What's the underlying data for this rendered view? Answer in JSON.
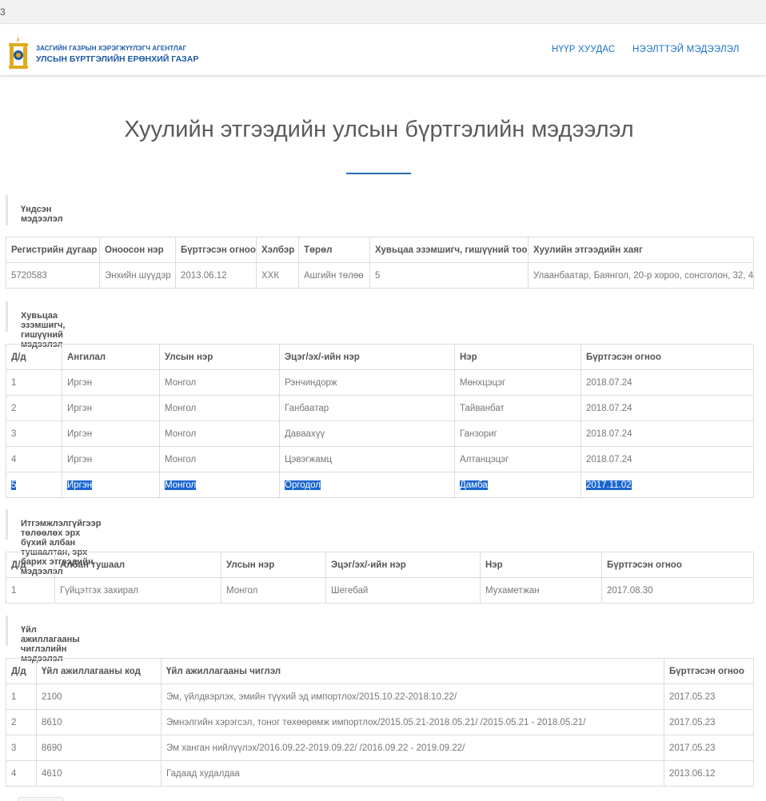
{
  "browser": {
    "strip_text": "3"
  },
  "header": {
    "logo_line1": "ЗАСГИЙН ГАЗРЫН ХЭРЭГЖҮҮЛЭГЧ АГЕНТЛАГ",
    "logo_line2": "УЛСЫН БҮРТГЭЛИЙН ЕРӨНХИЙ ГАЗАР",
    "nav": [
      {
        "label": "НҮҮР ХУУДАС"
      },
      {
        "label": "НЭЭЛТТЭЙ МЭДЭЭЛЭЛ"
      }
    ]
  },
  "page": {
    "title": "Хуулийн этгээдийн улсын бүртгэлийн мэдээлэл"
  },
  "basic": {
    "heading": "Үндсэн мэдээлэл",
    "columns": [
      "Регистрийн дугаар",
      "Оноосон нэр",
      "Бүртгэсэн огноо",
      "Хэлбэр",
      "Төрөл",
      "Хувьцаа эзэмшигч, гишүүний тоо",
      "Хуулийн этгээдийн хаяг"
    ],
    "rows": [
      [
        "5720583",
        "Энхийн шүүдэр",
        "2013.06.12",
        "ХХК",
        "Ашгийн төлөө",
        "5",
        "Улаанбаатар, Баянгол, 20-р хороо, сонсголон, 32, 4"
      ]
    ]
  },
  "shareholders": {
    "heading": "Хувьцаа эзэмшигч, гишүүний мэдээлэл",
    "columns": [
      "Д/д",
      "Ангилал",
      "Улсын нэр",
      "Эцэг/эх/-ийн нэр",
      "Нэр",
      "Бүртгэсэн огноо"
    ],
    "rows": [
      [
        "1",
        "Иргэн",
        "Монгол",
        "Рэнчиндорж",
        "Мөнхцэцэг",
        "2018.07.24"
      ],
      [
        "2",
        "Иргэн",
        "Монгол",
        "Ганбаатар",
        "Тайванбат",
        "2018.07.24"
      ],
      [
        "3",
        "Иргэн",
        "Монгол",
        "Даваахүү",
        "Ганзориг",
        "2018.07.24"
      ],
      [
        "4",
        "Иргэн",
        "Монгол",
        "Цэвэгжамц",
        "Алтанцэцэг",
        "2018.07.24"
      ],
      [
        "5",
        "Иргэн",
        "Монгол",
        "Оргодол",
        "Дамба",
        "2017.11.02"
      ]
    ]
  },
  "officials": {
    "heading": "Итгэмжлэлгүйгээр төлөөлөх эрх бүхий албан тушаалтан, эрх барих этгээдийн мэдээлэл",
    "columns": [
      "Д/д",
      "Албан тушаал",
      "Улсын нэр",
      "Эцэг/эх/-ийн нэр",
      "Нэр",
      "Бүртгэсэн огноо"
    ],
    "rows": [
      [
        "1",
        "Гүйцэтгэх захирал",
        "Монгол",
        "Шегебай",
        "Мухаметжан",
        "2017.08.30"
      ]
    ]
  },
  "activities": {
    "heading": "Үйл ажиллагааны чиглэлийн мэдээлэл",
    "columns": [
      "Д/д",
      "Үйл ажиллагааны код",
      "Үйл ажиллагааны чиглэл",
      "Бүртгэсэн огноо"
    ],
    "rows": [
      [
        "1",
        "2100",
        "Эм, үйлдвэрлэх, эмийн түүхий эд импортлох/2015.10.22-2018.10.22/",
        "2017.05.23"
      ],
      [
        "2",
        "8610",
        "Эмнэлгийн хэрэгсэл, тоног төхөөрөмж импортлох/2015.05.21-2018.05.21/ /2015.05.21 - 2018.05.21/",
        "2017.05.23"
      ],
      [
        "3",
        "8690",
        "Эм ханган нийлүүлэх/2016.09.22-2019.09.22/ /2016.09.22 - 2019.09.22/",
        "2017.05.23"
      ],
      [
        "4",
        "4610",
        "Гадаад худалдаа",
        "2013.06.12"
      ]
    ]
  },
  "colors": {
    "accent": "#1a73c9",
    "brand": "#1d5aa6",
    "selection": "#1a66d1",
    "emblem_gold": "#e0a91f"
  }
}
